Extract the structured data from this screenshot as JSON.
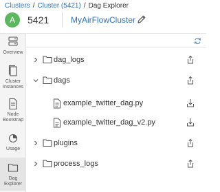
{
  "breadcrumb": {
    "clusters": "Clusters",
    "sep1": "/",
    "cluster": "Cluster (5421)",
    "sep2": "/",
    "current": "Dag Explorer"
  },
  "header": {
    "avatar_letter": "A",
    "cluster_id": "5421",
    "cluster_name": "MyAirFlowCluster"
  },
  "sidebar": {
    "items": [
      {
        "label": "Overview",
        "icon": "server-icon"
      },
      {
        "label": "Cluster Instances",
        "icon": "instances-icon"
      },
      {
        "label": "Node Bootstrap",
        "icon": "document-icon"
      },
      {
        "label": "Usage",
        "icon": "pie-chart-icon"
      },
      {
        "label": "Dag Explorer",
        "icon": "folder-icon",
        "active": true
      }
    ]
  },
  "tree": {
    "rows": [
      {
        "name": "dag_logs",
        "type": "folder",
        "expanded": false,
        "action": "upload"
      },
      {
        "name": "dags",
        "type": "folder",
        "expanded": true,
        "action": "upload"
      },
      {
        "name": "example_twitter_dag.py",
        "type": "file",
        "action": "download"
      },
      {
        "name": "example_twitter_dag_v2.py",
        "type": "file",
        "action": "download"
      },
      {
        "name": "plugins",
        "type": "folder",
        "expanded": false,
        "action": "upload"
      },
      {
        "name": "process_logs",
        "type": "folder",
        "expanded": false,
        "action": "upload"
      }
    ]
  },
  "colors": {
    "link": "#2f6fbd",
    "avatar": "#5cb85c",
    "sidebar_bg": "#f4f4f4"
  }
}
